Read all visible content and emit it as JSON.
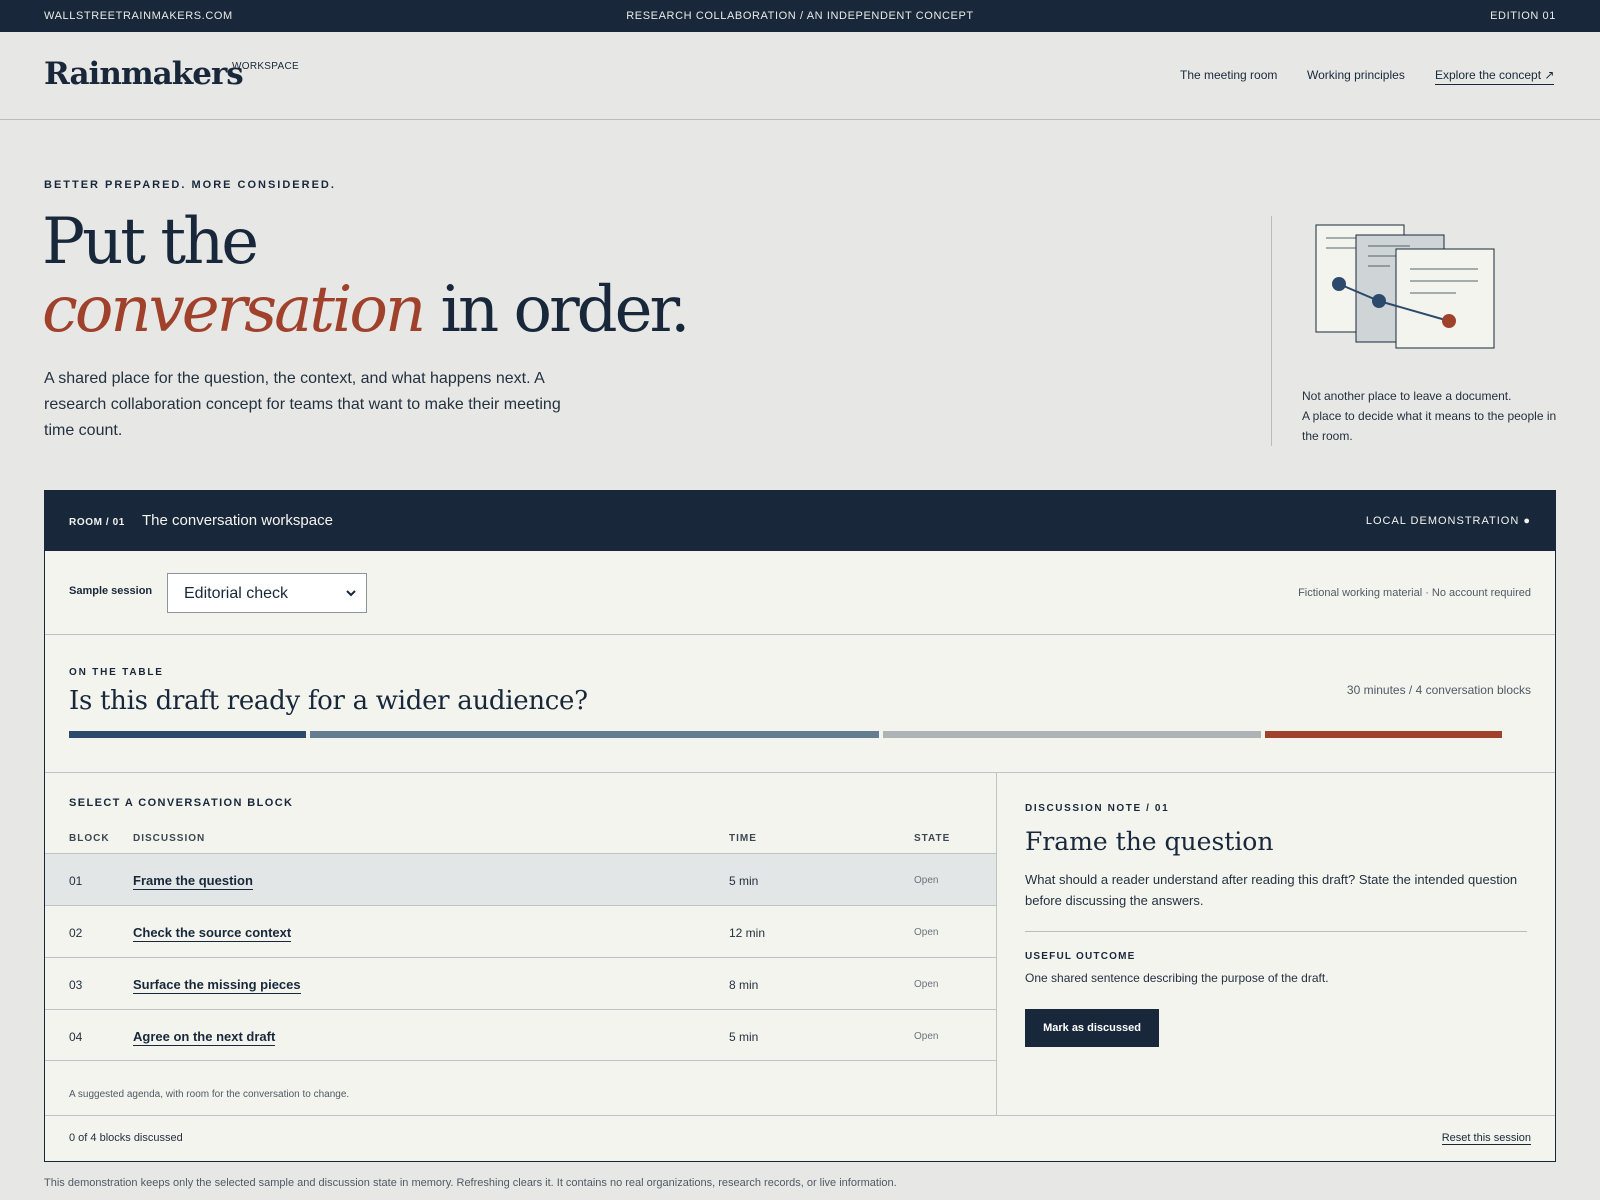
{
  "topbar": {
    "site": "WALLSTREETRAINMAKERS.COM",
    "tagline": "RESEARCH COLLABORATION / AN INDEPENDENT CONCEPT",
    "edition": "EDITION 01"
  },
  "header": {
    "brand": "Rainmakers",
    "brand_sub": "WORKSPACE",
    "nav": [
      "The meeting room",
      "Working principles",
      "Explore the concept ↗"
    ]
  },
  "hero": {
    "kicker": "BETTER PREPARED. MORE CONSIDERED.",
    "headline_line1": "Put the",
    "headline_accent": "conversation",
    "headline_rest": " in order.",
    "lede": "A shared place for the question, the context, and what happens next. A research collaboration concept for teams that want to make their meeting time count.",
    "aside_line1": "Not another place to leave a document.",
    "aside_line2": "A place to decide what it means to the people in the room."
  },
  "workspace": {
    "room_id": "ROOM / 01",
    "room_title": "The conversation workspace",
    "demo_tag": "LOCAL DEMONSTRATION ●",
    "session_label": "Sample session",
    "session_value": "Editorial check",
    "session_note": "Fictional working material · No account required",
    "on_the_table": "ON THE TABLE",
    "question": "Is this draft ready for a wider audience?",
    "duration": "30 minutes / 4 conversation blocks",
    "select_label": "SELECT A CONVERSATION BLOCK",
    "columns": [
      "BLOCK",
      "DISCUSSION",
      "TIME",
      "STATE"
    ],
    "blocks": [
      {
        "num": "01",
        "discussion": "Frame the question",
        "time": "5 min",
        "state": "Open"
      },
      {
        "num": "02",
        "discussion": "Check the source context",
        "time": "12 min",
        "state": "Open"
      },
      {
        "num": "03",
        "discussion": "Surface the missing pieces",
        "time": "8 min",
        "state": "Open"
      },
      {
        "num": "04",
        "discussion": "Agree on the next draft",
        "time": "5 min",
        "state": "Open"
      }
    ],
    "agenda_note": "A suggested agenda, with room for the conversation to change.",
    "note": {
      "kicker": "DISCUSSION NOTE / 01",
      "title": "Frame the question",
      "body": "What should a reader understand after reading this draft? State the intended question before discussing the answers.",
      "outcome_label": "USEFUL OUTCOME",
      "outcome_text": "One shared sentence describing the purpose of the draft.",
      "button": "Mark as discussed"
    },
    "progress": "0 of 4 blocks discussed",
    "reset": "Reset this session"
  },
  "disclaimer": "This demonstration keeps only the selected sample and discussion state in memory. Refreshing clears it. It contains no real organizations, research records, or live information.",
  "colors": {
    "navy": "#18283a",
    "rust": "#a0412c",
    "bar_block1": "#2c4a6b",
    "bar_block2": "#647d90",
    "bar_block3": "#aeb4b6",
    "bar_block4": "#a0412c"
  }
}
